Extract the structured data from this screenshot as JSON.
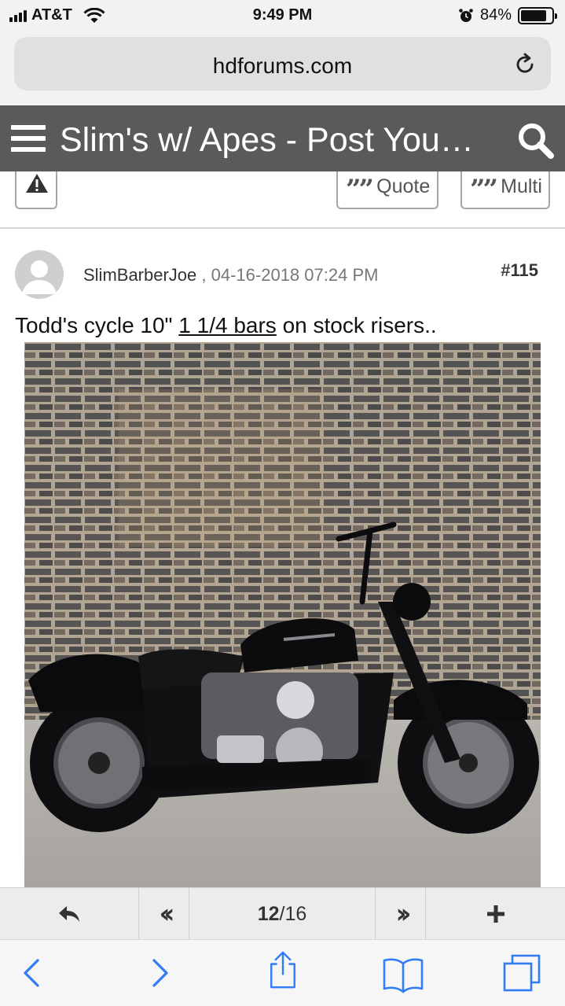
{
  "status_bar": {
    "carrier": "AT&T",
    "time": "9:49 PM",
    "battery": "84%",
    "battery_level": 0.84
  },
  "browser": {
    "url": "hdforums.com"
  },
  "forum_header": {
    "title": "Slim's w/ Apes - Post You…"
  },
  "post_actions": {
    "quote_label": "Quote",
    "multi_label": "Multi"
  },
  "post": {
    "author": "SlimBarberJoe",
    "separator": " , ",
    "date": "04-16-2018 07:24 PM",
    "number_hash": "#",
    "number": "115",
    "text_before": "Todd's cycle 10\" ",
    "link_text": "1 1/4 bars",
    "text_after": " on stock risers.."
  },
  "pagination": {
    "current_page": "12",
    "total_pages": "/16"
  },
  "colors": {
    "forum_header_bg": "#5a5a5a",
    "status_bar_bg": "#f2f2f2",
    "toolbar_icon": "#2f7cf6"
  },
  "icons": {
    "hamburger": "menu-icon",
    "search": "search-icon",
    "report": "warning-icon",
    "reload": "reload-icon",
    "reply": "reply-icon",
    "first": "double-chevron-left-icon",
    "last": "double-chevron-right-icon",
    "add": "plus-icon",
    "back": "chevron-left-icon",
    "forward": "chevron-right-icon",
    "share": "share-icon",
    "bookmarks": "book-icon",
    "tabs": "tabs-icon"
  }
}
